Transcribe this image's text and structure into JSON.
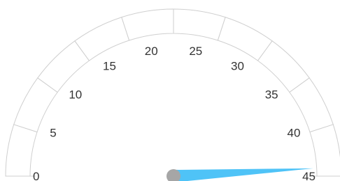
{
  "chart_data": {
    "type": "gauge",
    "min": 0,
    "max": 45,
    "value": 44.2,
    "tick_labels": [
      "0",
      "5",
      "10",
      "15",
      "20",
      "25",
      "30",
      "35",
      "40",
      "45"
    ],
    "band_count": 10,
    "colors": {
      "needle": "#4fc3f7",
      "needle_hub": "#a6a6a6",
      "band_stroke": "#cfcfcf",
      "label": "#333333",
      "background": "#ffffff"
    }
  }
}
